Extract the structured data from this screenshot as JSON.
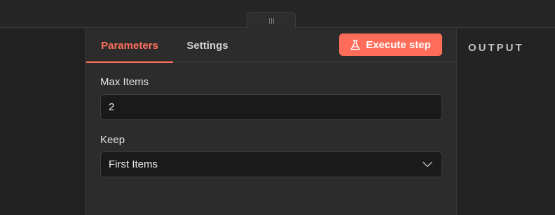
{
  "tabs": [
    {
      "label": "Parameters",
      "active": true
    },
    {
      "label": "Settings",
      "active": false
    }
  ],
  "execute_button": {
    "label": "Execute step",
    "icon": "flask-icon"
  },
  "fields": {
    "max_items": {
      "label": "Max Items",
      "value": "2"
    },
    "keep": {
      "label": "Keep",
      "value": "First Items"
    }
  },
  "output": {
    "title": "OUTPUT"
  },
  "colors": {
    "accent": "#ff6d5a",
    "background": "#2c2c2c",
    "input_bg": "#1a1a1a",
    "panel_dark": "#212121"
  }
}
